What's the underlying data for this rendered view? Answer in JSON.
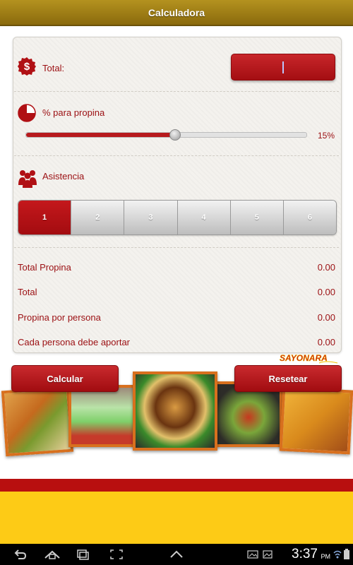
{
  "app": {
    "title": "Calculadora"
  },
  "form": {
    "total_label": "Total:",
    "total_value": "",
    "tip_label": "% para propina",
    "tip_percent": 15,
    "tip_percent_text": "15%",
    "slider_range": [
      0,
      100
    ],
    "attendance_label": "Asistencia",
    "attendance_options": [
      "1",
      "2",
      "3",
      "4",
      "5",
      "6"
    ],
    "attendance_selected": "1"
  },
  "results": [
    {
      "label": "Total Propina",
      "value": "0.00"
    },
    {
      "label": "Total",
      "value": "0.00"
    },
    {
      "label": "Propina por persona",
      "value": "0.00"
    },
    {
      "label": "Cada persona debe aportar",
      "value": "0.00"
    }
  ],
  "actions": {
    "calculate": "Calcular",
    "reset": "Resetear"
  },
  "brand": {
    "name": "SAYONARA"
  },
  "status": {
    "time": "3:37",
    "ampm": "PM"
  },
  "colors": {
    "accent": "#b71a1d",
    "titlebar": "#a27f17",
    "yellow": "#fdcb16"
  }
}
